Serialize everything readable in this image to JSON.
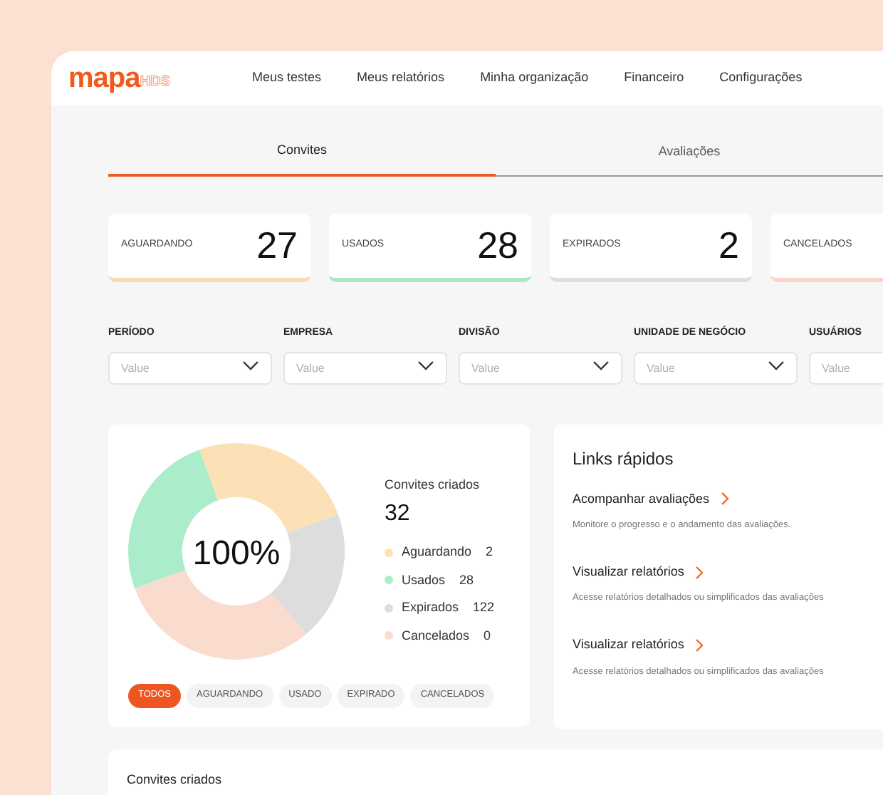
{
  "logo": {
    "main": "mapa",
    "suffix": "HDS"
  },
  "nav": [
    "Meus testes",
    "Meus relatórios",
    "Minha organização",
    "Financeiro",
    "Configurações"
  ],
  "tabs": [
    {
      "label": "Convites",
      "selected": true
    },
    {
      "label": "Avaliações",
      "selected": false
    }
  ],
  "stats": [
    {
      "label": "AGUARDANDO",
      "value": "27",
      "color": "#fcd9b4"
    },
    {
      "label": "USADOS",
      "value": "28",
      "color": "#a9e9c8"
    },
    {
      "label": "EXPIRADOS",
      "value": "2",
      "color": "#dedede"
    },
    {
      "label": "CANCELADOS",
      "color": "#fbd6c8"
    }
  ],
  "filters": [
    {
      "label": "PERÍODO",
      "placeholder": "Value"
    },
    {
      "label": "EMPRESA",
      "placeholder": "Value"
    },
    {
      "label": "DIVISÃO",
      "placeholder": "Value"
    },
    {
      "label": "UNIDADE DE NEGÓCIO",
      "placeholder": "Value"
    },
    {
      "label": "USUÁRIOS",
      "placeholder": "Value"
    }
  ],
  "summary": {
    "center": "100%",
    "title": "Convites criados",
    "total": "32",
    "legend": [
      {
        "label": "Aguardando",
        "value": "2",
        "color": "#fde1b6"
      },
      {
        "label": "Usados",
        "value": "28",
        "color": "#abecca"
      },
      {
        "label": "Expirados",
        "value": "122",
        "color": "#dddddd"
      },
      {
        "label": "Cancelados",
        "value": "0",
        "color": "#fadccf"
      }
    ],
    "chips": [
      {
        "label": "TODOS",
        "selected": true
      },
      {
        "label": "AGUARDANDO",
        "selected": false
      },
      {
        "label": "USADO",
        "selected": false
      },
      {
        "label": "EXPIRADO",
        "selected": false
      },
      {
        "label": "CANCELADOS",
        "selected": false
      }
    ]
  },
  "quick_links": {
    "title": "Links rápidos",
    "items": [
      {
        "title": "Acompanhar avaliações",
        "description": "Monitore o progresso e o andamento das avaliações."
      },
      {
        "title": "Visualizar relatórios",
        "description": "Acesse relatórios detalhados ou simplificados das avaliações"
      },
      {
        "title": "Visualizar relatórios",
        "description": "Acesse relatórios detalhados ou simplificados das avaliações"
      }
    ]
  },
  "table_card": {
    "title": "Convites criados"
  }
}
